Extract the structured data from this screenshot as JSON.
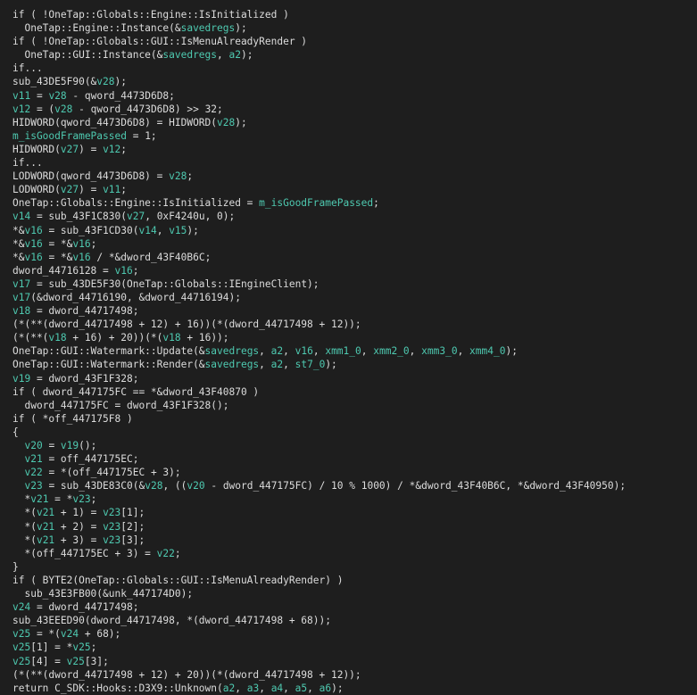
{
  "colors": {
    "background": "#1e1e1e",
    "plain_text": "#dcdcdc",
    "variable": "#4ec9b0"
  },
  "code": {
    "lines": [
      [
        {
          "t": "if ( !OneTap::Globals::Engine::IsInitialized )",
          "k": "p"
        }
      ],
      [
        {
          "t": "  OneTap::Engine::Instance(&",
          "k": "p"
        },
        {
          "t": "savedregs",
          "k": "v"
        },
        {
          "t": ");",
          "k": "p"
        }
      ],
      [
        {
          "t": "if ( !OneTap::Globals::GUI::IsMenuAlreadyRender )",
          "k": "p"
        }
      ],
      [
        {
          "t": "  OneTap::GUI::Instance(&",
          "k": "p"
        },
        {
          "t": "savedregs",
          "k": "v"
        },
        {
          "t": ", ",
          "k": "p"
        },
        {
          "t": "a2",
          "k": "v"
        },
        {
          "t": ");",
          "k": "p"
        }
      ],
      [
        {
          "t": "if...",
          "k": "p"
        }
      ],
      [
        {
          "t": "sub_43DE5F90(&",
          "k": "p"
        },
        {
          "t": "v28",
          "k": "v"
        },
        {
          "t": ");",
          "k": "p"
        }
      ],
      [
        {
          "t": "v11",
          "k": "v"
        },
        {
          "t": " = ",
          "k": "p"
        },
        {
          "t": "v28",
          "k": "v"
        },
        {
          "t": " - qword_4473D6D8;",
          "k": "p"
        }
      ],
      [
        {
          "t": "v12",
          "k": "v"
        },
        {
          "t": " = (",
          "k": "p"
        },
        {
          "t": "v28",
          "k": "v"
        },
        {
          "t": " - qword_4473D6D8) >> 32;",
          "k": "p"
        }
      ],
      [
        {
          "t": "HIDWORD(qword_4473D6D8) = HIDWORD(",
          "k": "p"
        },
        {
          "t": "v28",
          "k": "v"
        },
        {
          "t": ");",
          "k": "p"
        }
      ],
      [
        {
          "t": "m_isGoodFramePassed",
          "k": "v"
        },
        {
          "t": " = 1;",
          "k": "p"
        }
      ],
      [
        {
          "t": "HIDWORD(",
          "k": "p"
        },
        {
          "t": "v27",
          "k": "v"
        },
        {
          "t": ") = ",
          "k": "p"
        },
        {
          "t": "v12",
          "k": "v"
        },
        {
          "t": ";",
          "k": "p"
        }
      ],
      [
        {
          "t": "if...",
          "k": "p"
        }
      ],
      [
        {
          "t": "LODWORD(qword_4473D6D8) = ",
          "k": "p"
        },
        {
          "t": "v28",
          "k": "v"
        },
        {
          "t": ";",
          "k": "p"
        }
      ],
      [
        {
          "t": "LODWORD(",
          "k": "p"
        },
        {
          "t": "v27",
          "k": "v"
        },
        {
          "t": ") = ",
          "k": "p"
        },
        {
          "t": "v11",
          "k": "v"
        },
        {
          "t": ";",
          "k": "p"
        }
      ],
      [
        {
          "t": "OneTap::Globals::Engine::IsInitialized = ",
          "k": "p"
        },
        {
          "t": "m_isGoodFramePassed",
          "k": "v"
        },
        {
          "t": ";",
          "k": "p"
        }
      ],
      [
        {
          "t": "v14",
          "k": "v"
        },
        {
          "t": " = sub_43F1C830(",
          "k": "p"
        },
        {
          "t": "v27",
          "k": "v"
        },
        {
          "t": ", 0xF4240u, 0);",
          "k": "p"
        }
      ],
      [
        {
          "t": "*&",
          "k": "p"
        },
        {
          "t": "v16",
          "k": "v"
        },
        {
          "t": " = sub_43F1CD30(",
          "k": "p"
        },
        {
          "t": "v14",
          "k": "v"
        },
        {
          "t": ", ",
          "k": "p"
        },
        {
          "t": "v15",
          "k": "v"
        },
        {
          "t": ");",
          "k": "p"
        }
      ],
      [
        {
          "t": "*&",
          "k": "p"
        },
        {
          "t": "v16",
          "k": "v"
        },
        {
          "t": " = *&",
          "k": "p"
        },
        {
          "t": "v16",
          "k": "v"
        },
        {
          "t": ";",
          "k": "p"
        }
      ],
      [
        {
          "t": "*&",
          "k": "p"
        },
        {
          "t": "v16",
          "k": "v"
        },
        {
          "t": " = *&",
          "k": "p"
        },
        {
          "t": "v16",
          "k": "v"
        },
        {
          "t": " / *&dword_43F40B6C;",
          "k": "p"
        }
      ],
      [
        {
          "t": "dword_44716128 = ",
          "k": "p"
        },
        {
          "t": "v16",
          "k": "v"
        },
        {
          "t": ";",
          "k": "p"
        }
      ],
      [
        {
          "t": "v17",
          "k": "v"
        },
        {
          "t": " = sub_43DE5F30(OneTap::Globals::IEngineClient);",
          "k": "p"
        }
      ],
      [
        {
          "t": "v17",
          "k": "v"
        },
        {
          "t": "(&dword_44716190, &dword_44716194);",
          "k": "p"
        }
      ],
      [
        {
          "t": "v18",
          "k": "v"
        },
        {
          "t": " = dword_44717498;",
          "k": "p"
        }
      ],
      [
        {
          "t": "(*(**(dword_44717498 + 12) + 16))(*(dword_44717498 + 12));",
          "k": "p"
        }
      ],
      [
        {
          "t": "(*(**(",
          "k": "p"
        },
        {
          "t": "v18",
          "k": "v"
        },
        {
          "t": " + 16) + 20))(*(",
          "k": "p"
        },
        {
          "t": "v18",
          "k": "v"
        },
        {
          "t": " + 16));",
          "k": "p"
        }
      ],
      [
        {
          "t": "OneTap::GUI::Watermark::Update(&",
          "k": "p"
        },
        {
          "t": "savedregs",
          "k": "v"
        },
        {
          "t": ", ",
          "k": "p"
        },
        {
          "t": "a2",
          "k": "v"
        },
        {
          "t": ", ",
          "k": "p"
        },
        {
          "t": "v16",
          "k": "v"
        },
        {
          "t": ", ",
          "k": "p"
        },
        {
          "t": "xmm1_0",
          "k": "v"
        },
        {
          "t": ", ",
          "k": "p"
        },
        {
          "t": "xmm2_0",
          "k": "v"
        },
        {
          "t": ", ",
          "k": "p"
        },
        {
          "t": "xmm3_0",
          "k": "v"
        },
        {
          "t": ", ",
          "k": "p"
        },
        {
          "t": "xmm4_0",
          "k": "v"
        },
        {
          "t": ");",
          "k": "p"
        }
      ],
      [
        {
          "t": "OneTap::GUI::Watermark::Render(&",
          "k": "p"
        },
        {
          "t": "savedregs",
          "k": "v"
        },
        {
          "t": ", ",
          "k": "p"
        },
        {
          "t": "a2",
          "k": "v"
        },
        {
          "t": ", ",
          "k": "p"
        },
        {
          "t": "st7_0",
          "k": "v"
        },
        {
          "t": ");",
          "k": "p"
        }
      ],
      [
        {
          "t": "v19",
          "k": "v"
        },
        {
          "t": " = dword_43F1F328;",
          "k": "p"
        }
      ],
      [
        {
          "t": "if ( dword_447175FC == *&dword_43F40870 )",
          "k": "p"
        }
      ],
      [
        {
          "t": "  dword_447175FC = dword_43F1F328();",
          "k": "p"
        }
      ],
      [
        {
          "t": "if ( *off_447175F8 )",
          "k": "p"
        }
      ],
      [
        {
          "t": "{",
          "k": "p"
        }
      ],
      [
        {
          "t": "  ",
          "k": "p"
        },
        {
          "t": "v20",
          "k": "v"
        },
        {
          "t": " = ",
          "k": "p"
        },
        {
          "t": "v19",
          "k": "v"
        },
        {
          "t": "();",
          "k": "p"
        }
      ],
      [
        {
          "t": "  ",
          "k": "p"
        },
        {
          "t": "v21",
          "k": "v"
        },
        {
          "t": " = off_447175EC;",
          "k": "p"
        }
      ],
      [
        {
          "t": "  ",
          "k": "p"
        },
        {
          "t": "v22",
          "k": "v"
        },
        {
          "t": " = *(off_447175EC + 3);",
          "k": "p"
        }
      ],
      [
        {
          "t": "  ",
          "k": "p"
        },
        {
          "t": "v23",
          "k": "v"
        },
        {
          "t": " = sub_43DE83C0(&",
          "k": "p"
        },
        {
          "t": "v28",
          "k": "v"
        },
        {
          "t": ", ((",
          "k": "p"
        },
        {
          "t": "v20",
          "k": "v"
        },
        {
          "t": " - dword_447175FC) / 10 % 1000) / *&dword_43F40B6C, *&dword_43F40950);",
          "k": "p"
        }
      ],
      [
        {
          "t": "  *",
          "k": "p"
        },
        {
          "t": "v21",
          "k": "v"
        },
        {
          "t": " = *",
          "k": "p"
        },
        {
          "t": "v23",
          "k": "v"
        },
        {
          "t": ";",
          "k": "p"
        }
      ],
      [
        {
          "t": "  *(",
          "k": "p"
        },
        {
          "t": "v21",
          "k": "v"
        },
        {
          "t": " + 1) = ",
          "k": "p"
        },
        {
          "t": "v23",
          "k": "v"
        },
        {
          "t": "[1];",
          "k": "p"
        }
      ],
      [
        {
          "t": "  *(",
          "k": "p"
        },
        {
          "t": "v21",
          "k": "v"
        },
        {
          "t": " + 2) = ",
          "k": "p"
        },
        {
          "t": "v23",
          "k": "v"
        },
        {
          "t": "[2];",
          "k": "p"
        }
      ],
      [
        {
          "t": "  *(",
          "k": "p"
        },
        {
          "t": "v21",
          "k": "v"
        },
        {
          "t": " + 3) = ",
          "k": "p"
        },
        {
          "t": "v23",
          "k": "v"
        },
        {
          "t": "[3];",
          "k": "p"
        }
      ],
      [
        {
          "t": "  *(off_447175EC + 3) = ",
          "k": "p"
        },
        {
          "t": "v22",
          "k": "v"
        },
        {
          "t": ";",
          "k": "p"
        }
      ],
      [
        {
          "t": "}",
          "k": "p"
        }
      ],
      [
        {
          "t": "if ( BYTE2(OneTap::Globals::GUI::IsMenuAlreadyRender) )",
          "k": "p"
        }
      ],
      [
        {
          "t": "  sub_43E3FB00(&unk_447174D0);",
          "k": "p"
        }
      ],
      [
        {
          "t": "v24",
          "k": "v"
        },
        {
          "t": " = dword_44717498;",
          "k": "p"
        }
      ],
      [
        {
          "t": "sub_43EEED90(dword_44717498, *(dword_44717498 + 68));",
          "k": "p"
        }
      ],
      [
        {
          "t": "v25",
          "k": "v"
        },
        {
          "t": " = *(",
          "k": "p"
        },
        {
          "t": "v24",
          "k": "v"
        },
        {
          "t": " + 68);",
          "k": "p"
        }
      ],
      [
        {
          "t": "v25",
          "k": "v"
        },
        {
          "t": "[1] = *",
          "k": "p"
        },
        {
          "t": "v25",
          "k": "v"
        },
        {
          "t": ";",
          "k": "p"
        }
      ],
      [
        {
          "t": "v25",
          "k": "v"
        },
        {
          "t": "[4] = ",
          "k": "p"
        },
        {
          "t": "v25",
          "k": "v"
        },
        {
          "t": "[3];",
          "k": "p"
        }
      ],
      [
        {
          "t": "(*(**(dword_44717498 + 12) + 20))(*(dword_44717498 + 12));",
          "k": "p"
        }
      ],
      [
        {
          "t": "return C_SDK::Hooks::D3X9::Unknown(",
          "k": "p"
        },
        {
          "t": "a2",
          "k": "v"
        },
        {
          "t": ", ",
          "k": "p"
        },
        {
          "t": "a3",
          "k": "v"
        },
        {
          "t": ", ",
          "k": "p"
        },
        {
          "t": "a4",
          "k": "v"
        },
        {
          "t": ", ",
          "k": "p"
        },
        {
          "t": "a5",
          "k": "v"
        },
        {
          "t": ", ",
          "k": "p"
        },
        {
          "t": "a6",
          "k": "v"
        },
        {
          "t": ");",
          "k": "p"
        }
      ]
    ]
  }
}
